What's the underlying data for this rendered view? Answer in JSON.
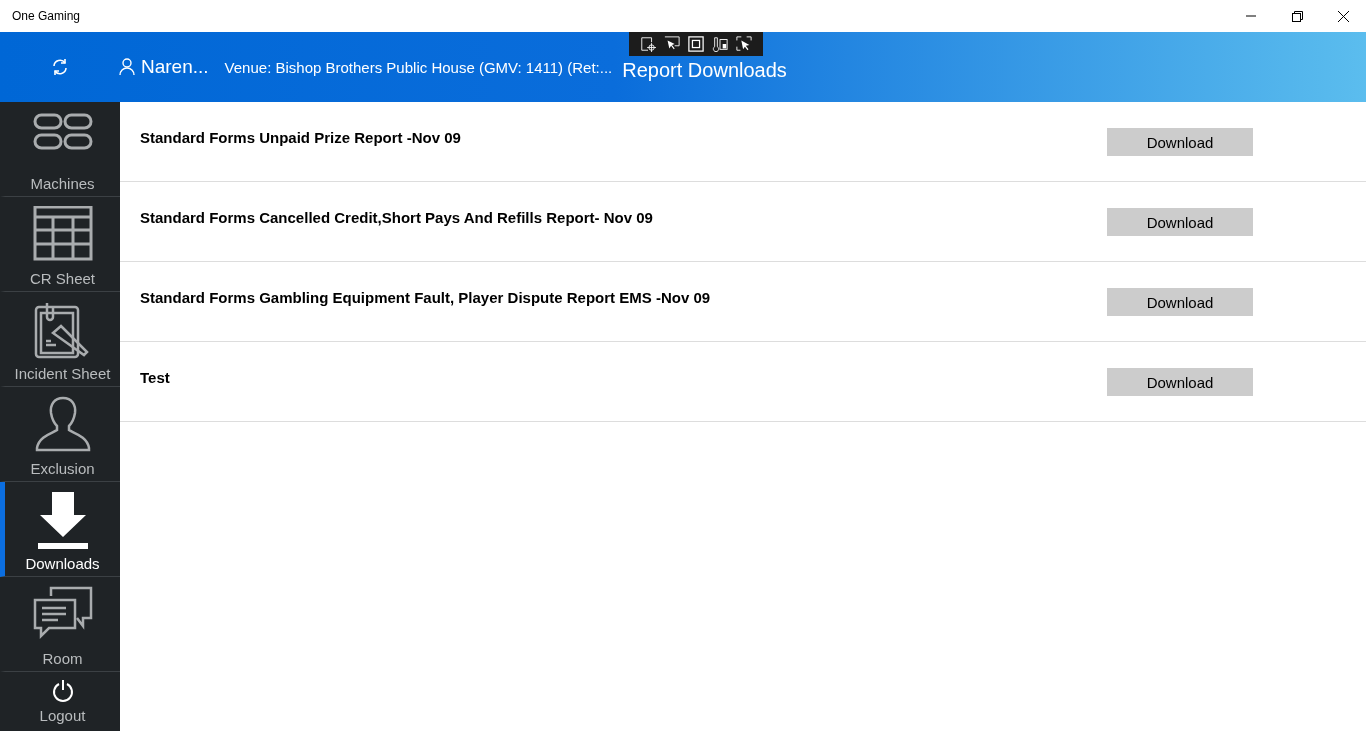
{
  "window": {
    "title": "One Gaming"
  },
  "header": {
    "user": "Naren...",
    "venue": "Venue: Bishop Brothers Public House (GMV: 1411) (Ret:...",
    "title": "Report Downloads"
  },
  "sidebar": {
    "items": [
      {
        "label": "Machines",
        "kind": "machines",
        "selected": false
      },
      {
        "label": "CR Sheet",
        "kind": "sheet",
        "selected": false
      },
      {
        "label": "Incident Sheet",
        "kind": "incident",
        "selected": false
      },
      {
        "label": "Exclusion",
        "kind": "person",
        "selected": false
      },
      {
        "label": "Downloads",
        "kind": "download",
        "selected": true
      },
      {
        "label": "Room",
        "kind": "chat",
        "selected": false
      },
      {
        "label": "Logout",
        "kind": "power",
        "selected": false
      }
    ]
  },
  "reports": [
    {
      "name": "Standard Forms Unpaid Prize Report -Nov 09",
      "button": "Download"
    },
    {
      "name": "Standard Forms Cancelled Credit,Short Pays And Refills Report- Nov 09",
      "button": "Download"
    },
    {
      "name": "Standard Forms Gambling Equipment Fault, Player Dispute Report EMS -Nov 09",
      "button": "Download"
    },
    {
      "name": "Test",
      "button": "Download"
    }
  ]
}
